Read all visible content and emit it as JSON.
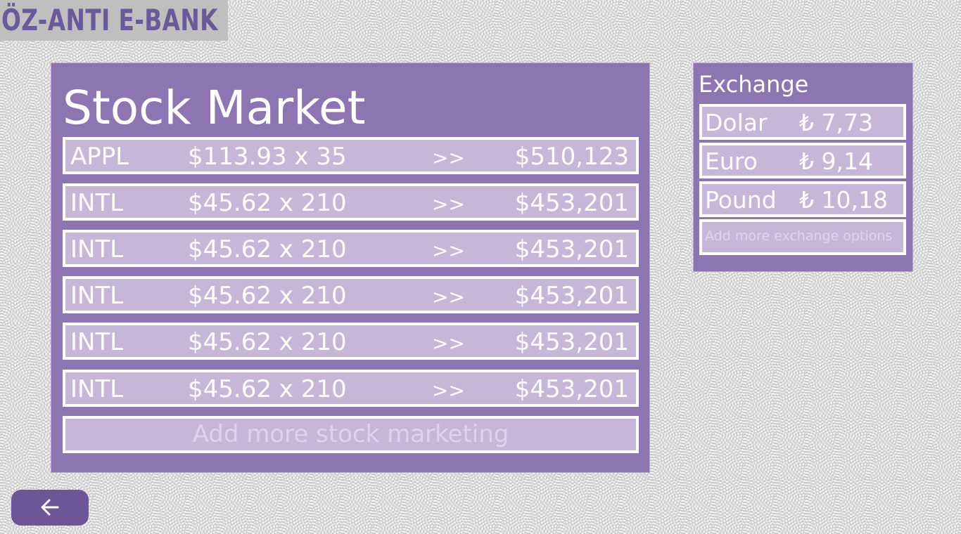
{
  "app": {
    "logo_text": "ÖZ-ANTI E-BANK"
  },
  "stock_market": {
    "title": "Stock Market",
    "rows": [
      {
        "symbol": "APPL",
        "price_qty": "$113.93 x 35",
        "arrow": ">>",
        "total": "$510,123"
      },
      {
        "symbol": "INTL",
        "price_qty": "$45.62 x 210",
        "arrow": ">>",
        "total": "$453,201"
      },
      {
        "symbol": "INTL",
        "price_qty": "$45.62 x 210",
        "arrow": ">>",
        "total": "$453,201"
      },
      {
        "symbol": "INTL",
        "price_qty": "$45.62 x 210",
        "arrow": ">>",
        "total": "$453,201"
      },
      {
        "symbol": "INTL",
        "price_qty": "$45.62 x 210",
        "arrow": ">>",
        "total": "$453,201"
      },
      {
        "symbol": "INTL",
        "price_qty": "$45.62 x 210",
        "arrow": ">>",
        "total": "$453,201"
      }
    ],
    "add_label": "Add more stock marketing"
  },
  "exchange": {
    "title": "Exchange",
    "rows": [
      {
        "currency": "Dolar",
        "rate": "₺ 7,73"
      },
      {
        "currency": "Euro",
        "rate": "₺ 9,14"
      },
      {
        "currency": "Pound",
        "rate": "₺ 10,18"
      }
    ],
    "add_label": "Add more exchange options"
  },
  "nav": {
    "back_icon": "arrow-left-icon"
  },
  "colors": {
    "panel": "#8c75b1",
    "row": "#c6b7d9",
    "accent": "#6e5597",
    "logo_text": "#6a5a9a"
  }
}
